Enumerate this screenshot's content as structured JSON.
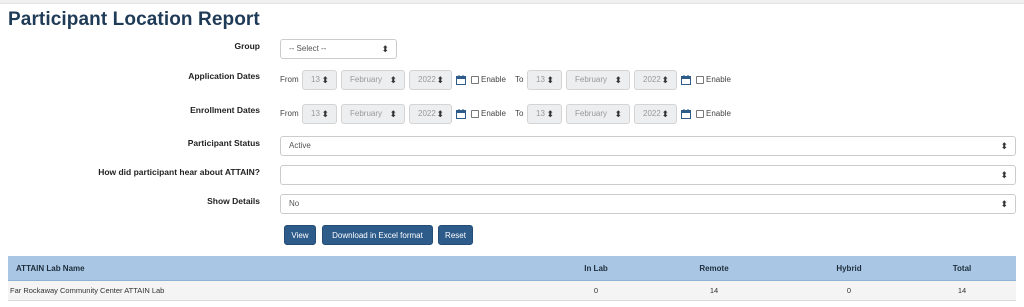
{
  "page": {
    "title": "Participant Location Report"
  },
  "form": {
    "group": {
      "label": "Group",
      "value": "-- Select --"
    },
    "application_dates": {
      "label": "Application Dates",
      "from_label": "From",
      "from_day": "13",
      "from_month": "February",
      "from_year": "2022",
      "enable_label": "Enable",
      "to_label": "To",
      "to_day": "13",
      "to_month": "February",
      "to_year": "2022",
      "enable2_label": "Enable"
    },
    "enrollment_dates": {
      "label": "Enrollment Dates",
      "from_label": "From",
      "from_day": "13",
      "from_month": "February",
      "from_year": "2022",
      "enable_label": "Enable",
      "to_label": "To",
      "to_day": "13",
      "to_month": "February",
      "to_year": "2022",
      "enable2_label": "Enable"
    },
    "participant_status": {
      "label": "Participant Status",
      "value": "Active"
    },
    "hear_about": {
      "label": "How did participant hear about ATTAIN?",
      "value": ""
    },
    "show_details": {
      "label": "Show Details",
      "value": "No"
    }
  },
  "buttons": {
    "view": "View",
    "download": "Download in Excel format",
    "reset": "Reset"
  },
  "table": {
    "headers": [
      "ATTAIN Lab Name",
      "In Lab",
      "Remote",
      "Hybrid",
      "Total"
    ],
    "rows": [
      [
        "Far Rockaway Community Center ATTAIN Lab",
        "0",
        "14",
        "0",
        "14"
      ]
    ]
  },
  "colors": {
    "title": "#1f3b57",
    "button": "#2d5b8a",
    "table_header": "#a9c7e4"
  },
  "icons": {
    "calendar": "calendar-icon",
    "caret": "sort-caret-icon"
  }
}
